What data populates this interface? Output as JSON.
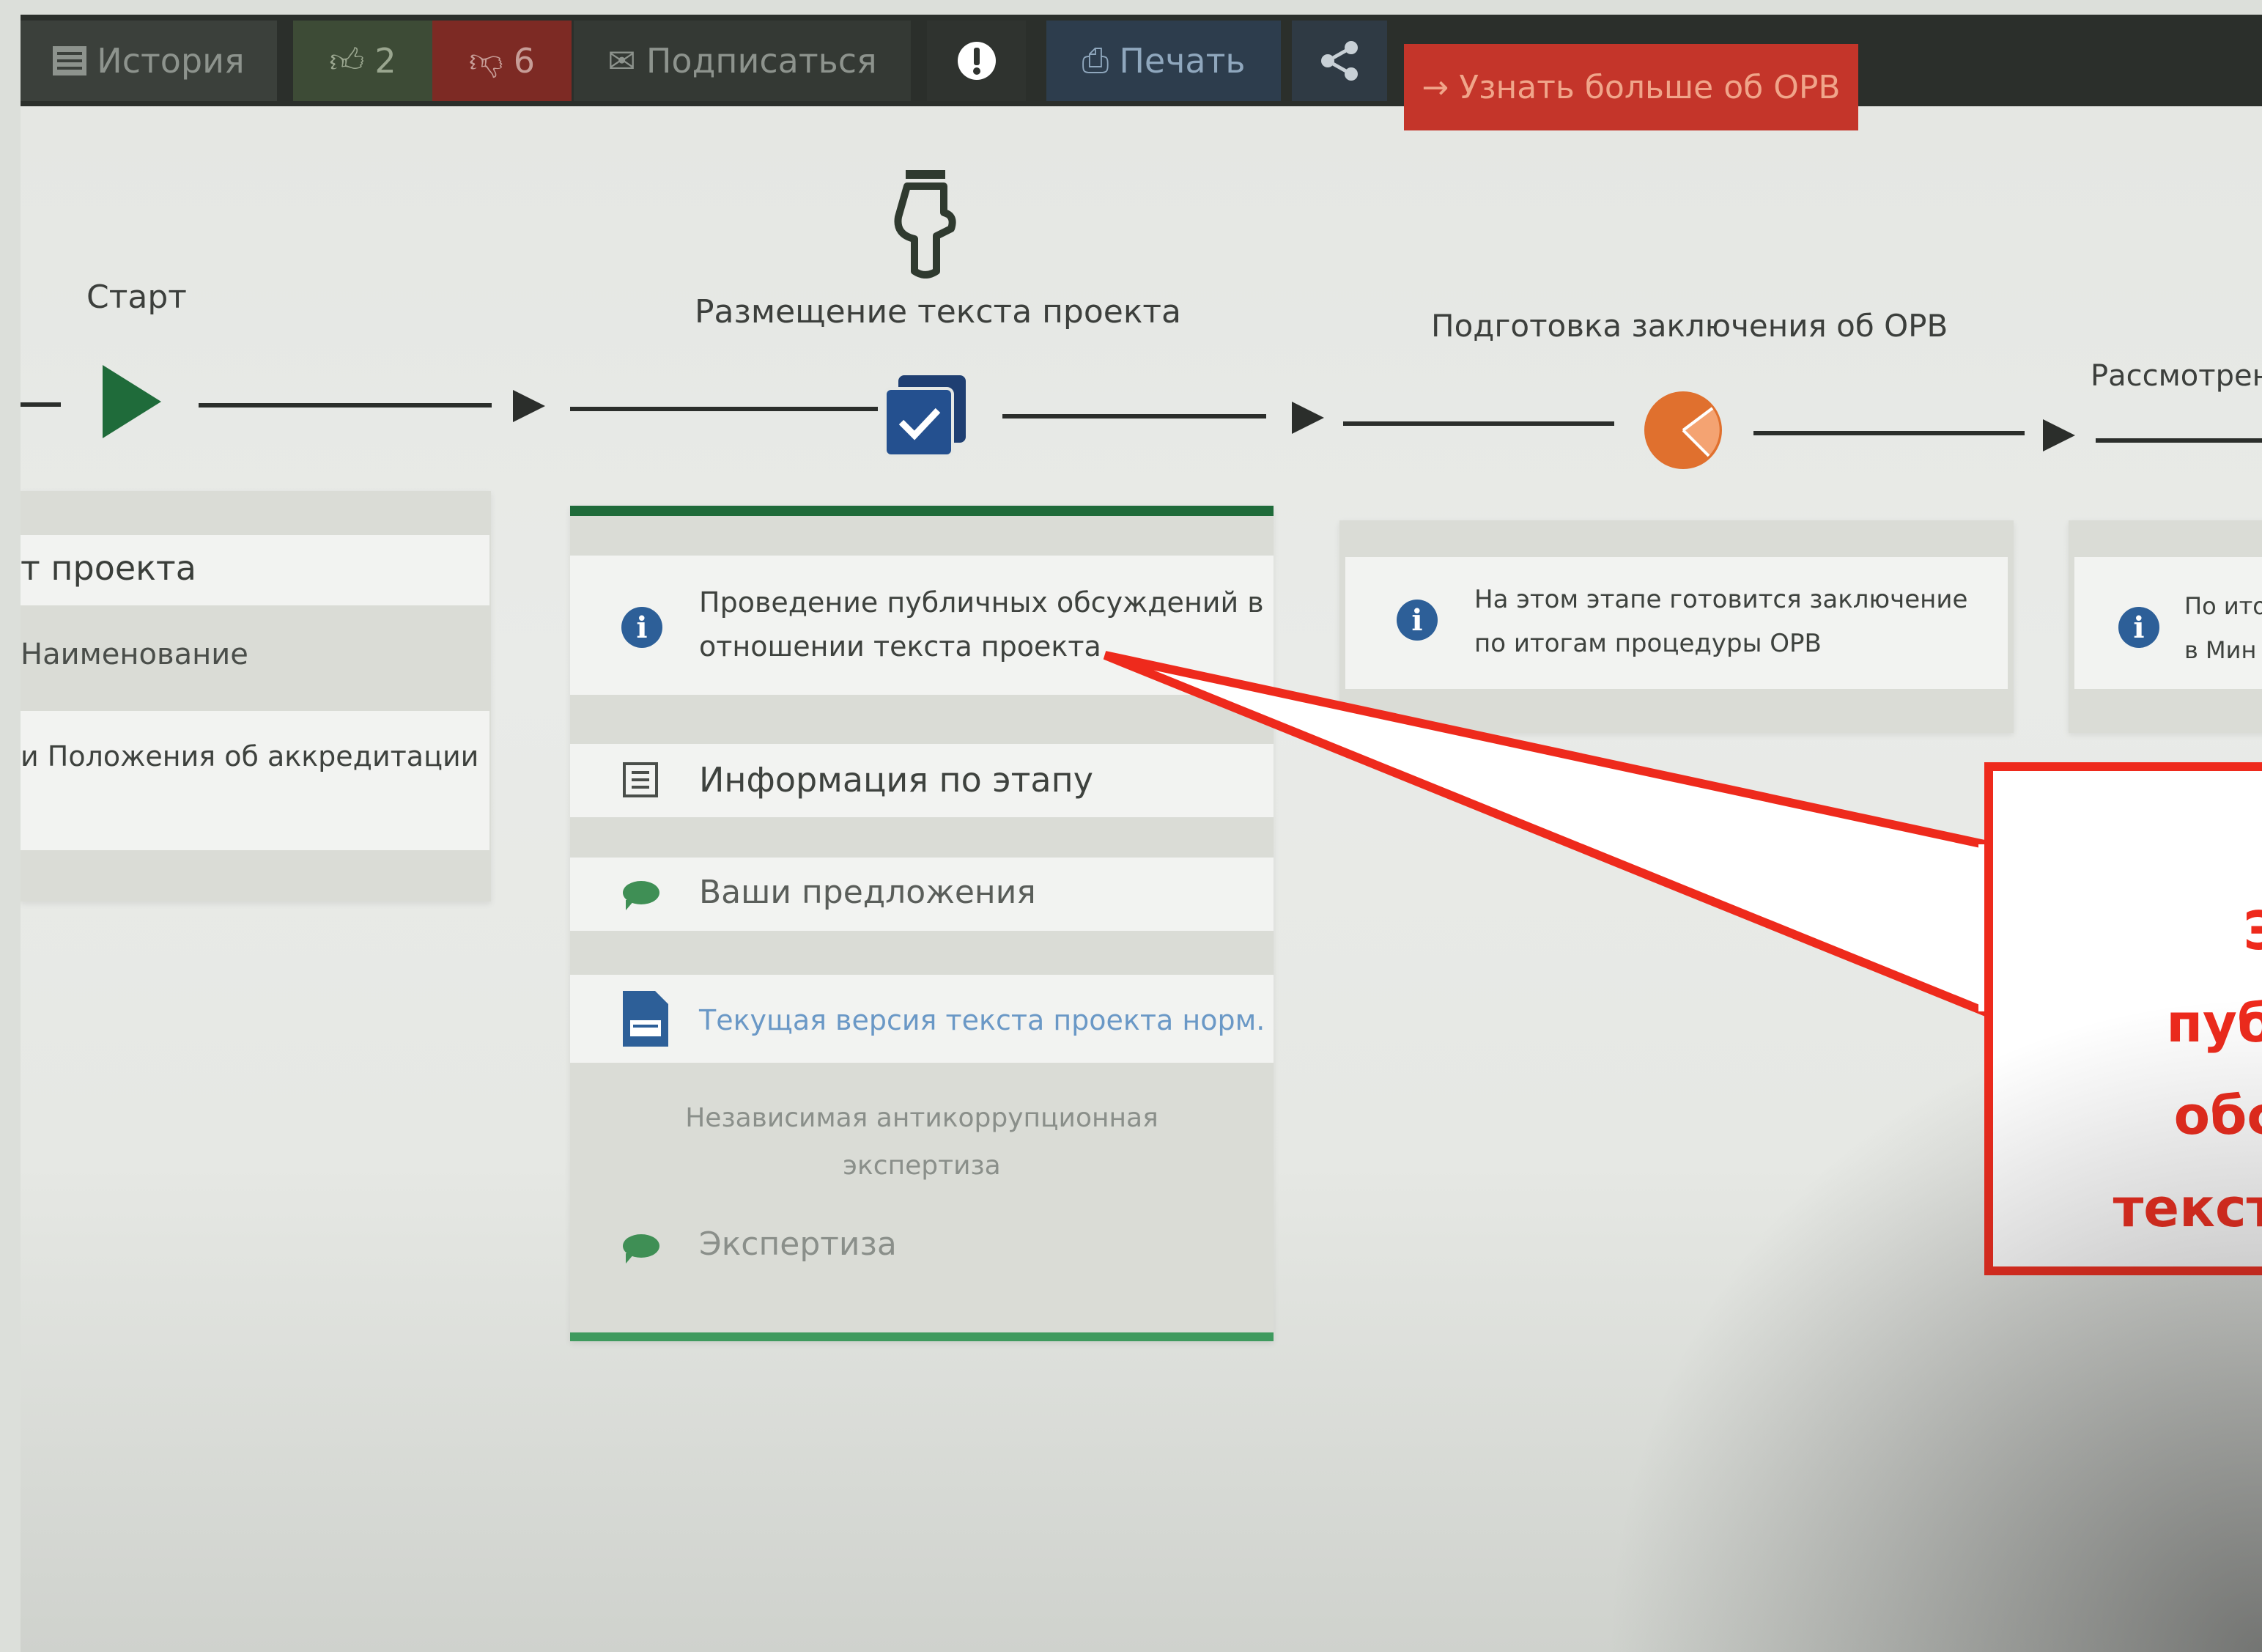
{
  "toolbar": {
    "history": "История",
    "likes": "2",
    "dislikes": "6",
    "subscribe": "Подписаться",
    "print": "Печать",
    "learn_more": "Узнать больше об ОРВ"
  },
  "stages": [
    {
      "title": "Старт"
    },
    {
      "title": "Размещение текста проекта"
    },
    {
      "title": "Подготовка заключения об ОРВ"
    },
    {
      "title": "Рассмотрени"
    }
  ],
  "start_panel": {
    "row1": "т проекта",
    "row2": "Наименование",
    "row3": "и Положения об аккредитации"
  },
  "project_panel": {
    "info_line1": "Проведение публичных обсуждений в",
    "info_line2": "отношении текста проекта",
    "stage_info": "Информация по этапу",
    "proposals": "Ваши предложения",
    "current_version": "Текущая версия текста проекта норм.",
    "anticorruption_line1": "Независимая антикоррупционная",
    "anticorruption_line2": "экспертиза",
    "expertise": "Экспертиза"
  },
  "orv_panel": {
    "info_line1": "На этом этапе готовится заключение",
    "info_line2": "по итогам процедуры ОРВ"
  },
  "review_panel": {
    "info_line1": "По ито",
    "info_line2": "в Мин"
  },
  "callout": {
    "line1": "Эт",
    "line2": "публ",
    "line3": "обсу",
    "line4": "текста"
  },
  "colors": {
    "accent_red": "#ee2a1c",
    "info_blue": "#2d5f98",
    "stage_orange": "#e0702e",
    "progress_green": "#1f6b3a",
    "toolbar_dark": "#2b2f2b"
  }
}
